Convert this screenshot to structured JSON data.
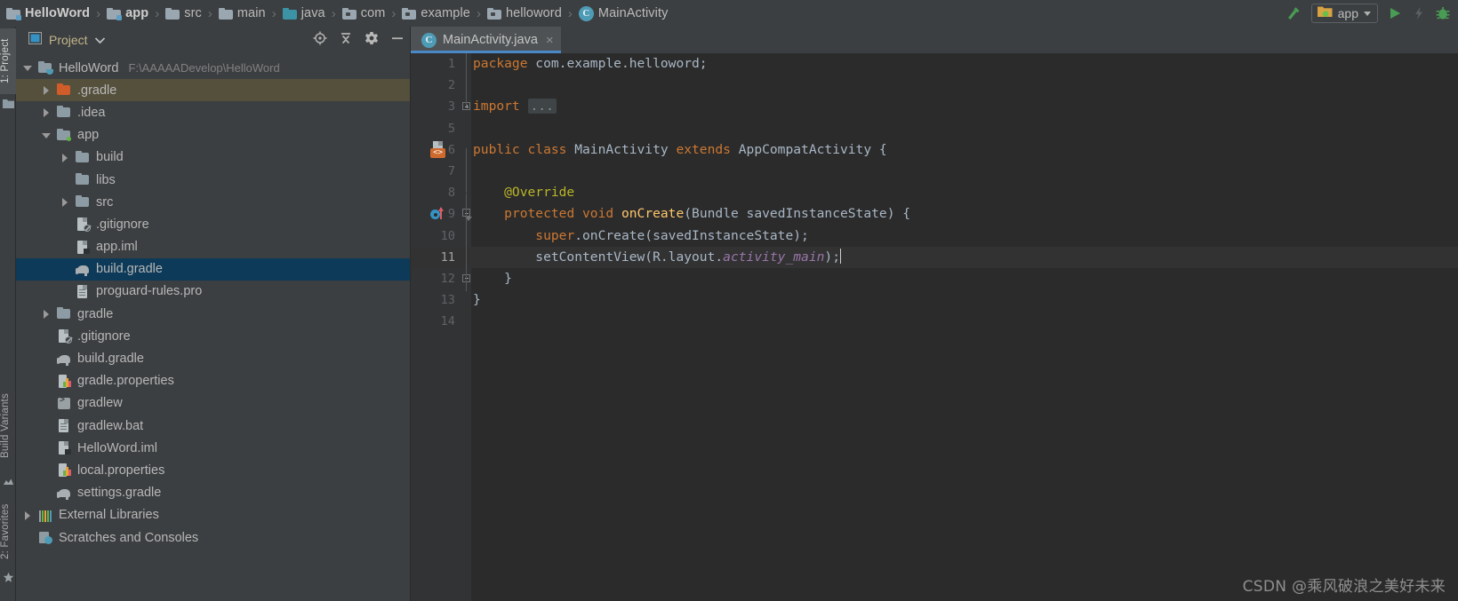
{
  "breadcrumb": {
    "items": [
      {
        "label": "HelloWord",
        "icon": "module-folder-icon",
        "bold": true
      },
      {
        "label": "app",
        "icon": "module-folder-icon",
        "bold": true
      },
      {
        "label": "src",
        "icon": "folder-icon",
        "bold": false
      },
      {
        "label": "main",
        "icon": "folder-icon",
        "bold": false
      },
      {
        "label": "java",
        "icon": "source-folder-icon",
        "bold": false
      },
      {
        "label": "com",
        "icon": "package-icon",
        "bold": false
      },
      {
        "label": "example",
        "icon": "package-icon",
        "bold": false
      },
      {
        "label": "helloword",
        "icon": "package-icon",
        "bold": false
      },
      {
        "label": "MainActivity",
        "icon": "java-class-icon",
        "bold": false
      }
    ],
    "separator": "›"
  },
  "toolbar": {
    "build_title": "Make Project",
    "run_config_label": "app",
    "run_title": "Run",
    "apply_changes_title": "Apply Changes",
    "debug_title": "Debug"
  },
  "left_strip": {
    "tabs": [
      {
        "label": "1: Project",
        "active": true
      },
      {
        "label": "Build Variants",
        "active": false
      },
      {
        "label": "2: Favorites",
        "active": false
      }
    ]
  },
  "project_panel": {
    "title": "Project",
    "actions": [
      "locate-icon",
      "collapse-all-icon",
      "settings-icon",
      "minimize-icon"
    ],
    "tree": [
      {
        "indent": 0,
        "arrow": "down",
        "icon": "project-folder-icon",
        "label": "HelloWord",
        "path": "F:\\AAAAADevelop\\HelloWord",
        "state": "normal"
      },
      {
        "indent": 1,
        "arrow": "right",
        "icon": "folder-orange-icon",
        "label": ".gradle",
        "path": "",
        "state": "hovered"
      },
      {
        "indent": 1,
        "arrow": "right",
        "icon": "folder-icon",
        "label": ".idea",
        "path": "",
        "state": "normal"
      },
      {
        "indent": 1,
        "arrow": "down",
        "icon": "module-folder-icon",
        "label": "app",
        "path": "",
        "state": "normal"
      },
      {
        "indent": 2,
        "arrow": "right",
        "icon": "folder-icon",
        "label": "build",
        "path": "",
        "state": "normal"
      },
      {
        "indent": 2,
        "arrow": "none",
        "icon": "folder-icon",
        "label": "libs",
        "path": "",
        "state": "normal"
      },
      {
        "indent": 2,
        "arrow": "right",
        "icon": "folder-icon",
        "label": "src",
        "path": "",
        "state": "normal"
      },
      {
        "indent": 2,
        "arrow": "none",
        "icon": "gitignore-icon",
        "label": ".gitignore",
        "path": "",
        "state": "normal"
      },
      {
        "indent": 2,
        "arrow": "none",
        "icon": "iml-file-icon",
        "label": "app.iml",
        "path": "",
        "state": "normal"
      },
      {
        "indent": 2,
        "arrow": "none",
        "icon": "gradle-file-icon",
        "label": "build.gradle",
        "path": "",
        "state": "selected"
      },
      {
        "indent": 2,
        "arrow": "none",
        "icon": "text-file-icon",
        "label": "proguard-rules.pro",
        "path": "",
        "state": "normal"
      },
      {
        "indent": 1,
        "arrow": "right",
        "icon": "folder-icon",
        "label": "gradle",
        "path": "",
        "state": "normal"
      },
      {
        "indent": 1,
        "arrow": "none",
        "icon": "gitignore-icon",
        "label": ".gitignore",
        "path": "",
        "state": "normal"
      },
      {
        "indent": 1,
        "arrow": "none",
        "icon": "gradle-file-icon",
        "label": "build.gradle",
        "path": "",
        "state": "normal"
      },
      {
        "indent": 1,
        "arrow": "none",
        "icon": "properties-file-icon",
        "label": "gradle.properties",
        "path": "",
        "state": "normal"
      },
      {
        "indent": 1,
        "arrow": "none",
        "icon": "shell-script-icon",
        "label": "gradlew",
        "path": "",
        "state": "normal"
      },
      {
        "indent": 1,
        "arrow": "none",
        "icon": "text-file-icon",
        "label": "gradlew.bat",
        "path": "",
        "state": "normal"
      },
      {
        "indent": 1,
        "arrow": "none",
        "icon": "iml-file-icon",
        "label": "HelloWord.iml",
        "path": "",
        "state": "normal"
      },
      {
        "indent": 1,
        "arrow": "none",
        "icon": "properties-file-icon",
        "label": "local.properties",
        "path": "",
        "state": "normal"
      },
      {
        "indent": 1,
        "arrow": "none",
        "icon": "gradle-file-icon",
        "label": "settings.gradle",
        "path": "",
        "state": "normal"
      },
      {
        "indent": 0,
        "arrow": "right",
        "icon": "libraries-icon",
        "label": "External Libraries",
        "path": "",
        "state": "normal"
      },
      {
        "indent": 0,
        "arrow": "none",
        "icon": "scratches-icon",
        "label": "Scratches and Consoles",
        "path": "",
        "state": "normal"
      }
    ]
  },
  "editor": {
    "tabs": [
      {
        "label": "MainActivity.java",
        "icon": "java-class-icon",
        "active": true,
        "close": "×"
      }
    ],
    "lines": [
      {
        "num": "1",
        "fold": "none",
        "gutter": "none",
        "current": false,
        "tokens": [
          {
            "t": "package",
            "c": "kw"
          },
          {
            "t": " com.example.helloword;",
            "c": "pln"
          }
        ]
      },
      {
        "num": "2",
        "fold": "none",
        "gutter": "none",
        "current": false,
        "tokens": []
      },
      {
        "num": "3",
        "fold": "plus",
        "gutter": "none",
        "current": false,
        "tokens": [
          {
            "t": "import",
            "c": "kw"
          },
          {
            "t": " ",
            "c": "pln"
          },
          {
            "t": "...",
            "c": "folded"
          }
        ]
      },
      {
        "num": "5",
        "fold": "none",
        "gutter": "none",
        "current": false,
        "tokens": []
      },
      {
        "num": "6",
        "fold": "none",
        "gutter": "layout",
        "current": false,
        "tokens": [
          {
            "t": "public class",
            "c": "kw"
          },
          {
            "t": " MainActivity ",
            "c": "pln"
          },
          {
            "t": "extends",
            "c": "kw"
          },
          {
            "t": " AppCompatActivity {",
            "c": "pln"
          }
        ]
      },
      {
        "num": "7",
        "fold": "none",
        "gutter": "none",
        "current": false,
        "tokens": []
      },
      {
        "num": "8",
        "fold": "none",
        "gutter": "none",
        "current": false,
        "tokens": [
          {
            "t": "    @Override",
            "c": "ann"
          }
        ]
      },
      {
        "num": "9",
        "fold": "arrow",
        "gutter": "override",
        "current": false,
        "tokens": [
          {
            "t": "    ",
            "c": "pln"
          },
          {
            "t": "protected void",
            "c": "kw"
          },
          {
            "t": " ",
            "c": "pln"
          },
          {
            "t": "onCreate",
            "c": "mth"
          },
          {
            "t": "(Bundle savedInstanceState) {",
            "c": "pln"
          }
        ]
      },
      {
        "num": "10",
        "fold": "none",
        "gutter": "none",
        "current": false,
        "tokens": [
          {
            "t": "        ",
            "c": "pln"
          },
          {
            "t": "super",
            "c": "kw"
          },
          {
            "t": ".onCreate(savedInstanceState);",
            "c": "pln"
          }
        ]
      },
      {
        "num": "11",
        "fold": "none",
        "gutter": "none",
        "current": true,
        "tokens": [
          {
            "t": "        setContentView(R.layout.",
            "c": "pln"
          },
          {
            "t": "activity_main",
            "c": "fld"
          },
          {
            "t": ");",
            "c": "pln"
          },
          {
            "t": "",
            "c": "caret"
          }
        ]
      },
      {
        "num": "12",
        "fold": "end",
        "gutter": "none",
        "current": false,
        "tokens": [
          {
            "t": "    }",
            "c": "pln"
          }
        ]
      },
      {
        "num": "13",
        "fold": "none",
        "gutter": "none",
        "current": false,
        "tokens": [
          {
            "t": "}",
            "c": "pln"
          }
        ]
      },
      {
        "num": "14",
        "fold": "none",
        "gutter": "none",
        "current": false,
        "tokens": []
      }
    ]
  },
  "watermark": {
    "text": "CSDN @乘风破浪之美好未来"
  },
  "colors": {
    "panel_bg": "#3c3f41",
    "editor_bg": "#2b2b2b",
    "gutter_bg": "#313335",
    "selection_blue": "#0d3a58",
    "hover_olive": "#55503c",
    "tab_underline": "#4a88c7",
    "keyword_orange": "#cc7832",
    "annotation_yellow": "#bbb529",
    "method_gold": "#ffc66d",
    "field_purple": "#9876aa",
    "plain_text": "#a9b7c6",
    "accent_green": "#62b543"
  }
}
